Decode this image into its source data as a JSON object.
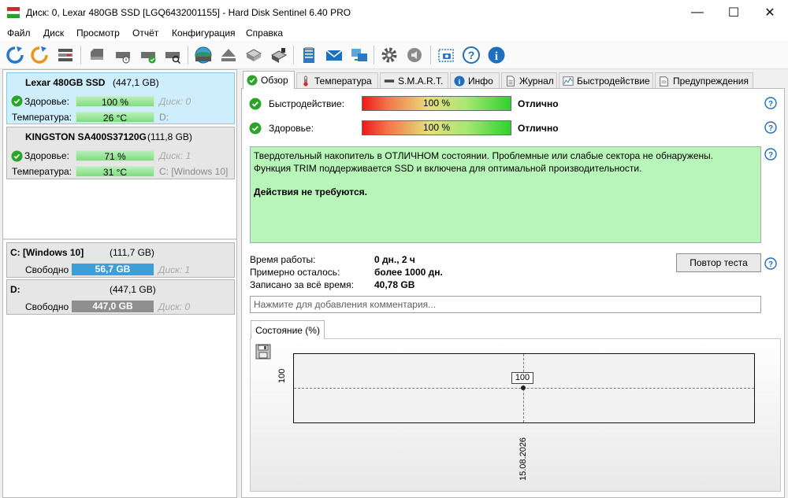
{
  "window": {
    "title": "Диск: 0, Lexar 480GB SSD [LGQ6432001155]  -  Hard Disk Sentinel 6.40 PRO",
    "minimize": "—",
    "maximize": "☐",
    "close": "✕"
  },
  "menu": [
    "Файл",
    "Диск",
    "Просмотр",
    "Отчёт",
    "Конфигурация",
    "Справка"
  ],
  "toolbar": {
    "icons": [
      "refresh-icon",
      "refresh-all-icon",
      "disk-list-icon",
      "disk-icon",
      "disk-temp-icon",
      "disk-ok-icon",
      "disk-search-icon",
      "hdd-scan-icon",
      "eject-icon",
      "network-disk-icon",
      "usb-disk-icon",
      "report-icon",
      "email-icon",
      "send-icon",
      "settings-icon",
      "sound-icon",
      "screenshot-icon",
      "help-icon",
      "info-icon"
    ]
  },
  "disks": [
    {
      "name": "Lexar 480GB SSD",
      "size": "(447,1 GB)",
      "health_label": "Здоровье:",
      "health_value": "100 %",
      "health_disk": "Диск: 0",
      "temp_label": "Температура:",
      "temp_value": "26 °C",
      "temp_drive": "D:"
    },
    {
      "name": "KINGSTON SA400S37120G",
      "size": "(111,8 GB)",
      "health_label": "Здоровье:",
      "health_value": "71 %",
      "health_disk": "Диск: 1",
      "temp_label": "Температура:",
      "temp_value": "31 °C",
      "temp_drive": "C: [Windows 10]"
    }
  ],
  "volumes": [
    {
      "name": "C: [Windows 10]",
      "size": "(111,7 GB)",
      "free_label": "Свободно",
      "free_value": "56,7 GB",
      "disk": "Диск: 1",
      "color": "#3d9fd8"
    },
    {
      "name": "D:",
      "size": "(447,1 GB)",
      "free_label": "Свободно",
      "free_value": "447,0 GB",
      "disk": "Диск: 0",
      "color": "#8f8f8f"
    }
  ],
  "tabs": [
    "Обзор",
    "Температура",
    "S.M.A.R.T.",
    "Инфо",
    "Журнал",
    "Быстродействие",
    "Предупреждения"
  ],
  "overview": {
    "performance_label": "Быстродействие:",
    "performance_value": "100 %",
    "performance_result": "Отлично",
    "health_label": "Здоровье:",
    "health_value": "100 %",
    "health_result": "Отлично",
    "status_line1": "Твердотельный накопитель в ОТЛИЧНОМ состоянии. Проблемные или слабые сектора не обнаружены.",
    "status_line2": "Функция TRIM поддерживается SSD и включена для оптимальной производительности.",
    "status_action": "Действия не требуются.",
    "uptime_label": "Время работы:",
    "uptime_value": "0 дн., 2 ч",
    "remaining_label": "Примерно осталось:",
    "remaining_value": "более 1000 дн.",
    "written_label": "Записано за всё время:",
    "written_value": "40,78 GB",
    "retest_button": "Повтор теста",
    "comment_placeholder": "Нажмите для добавления комментария..."
  },
  "chart_data": {
    "type": "line",
    "tab_label": "Состояние (%)",
    "x": [
      "15.08.2026"
    ],
    "series": [
      {
        "values": [
          100
        ]
      }
    ],
    "point_label": "100",
    "y_tick": "100",
    "x_tick": "15.08.2026",
    "grid": false
  }
}
